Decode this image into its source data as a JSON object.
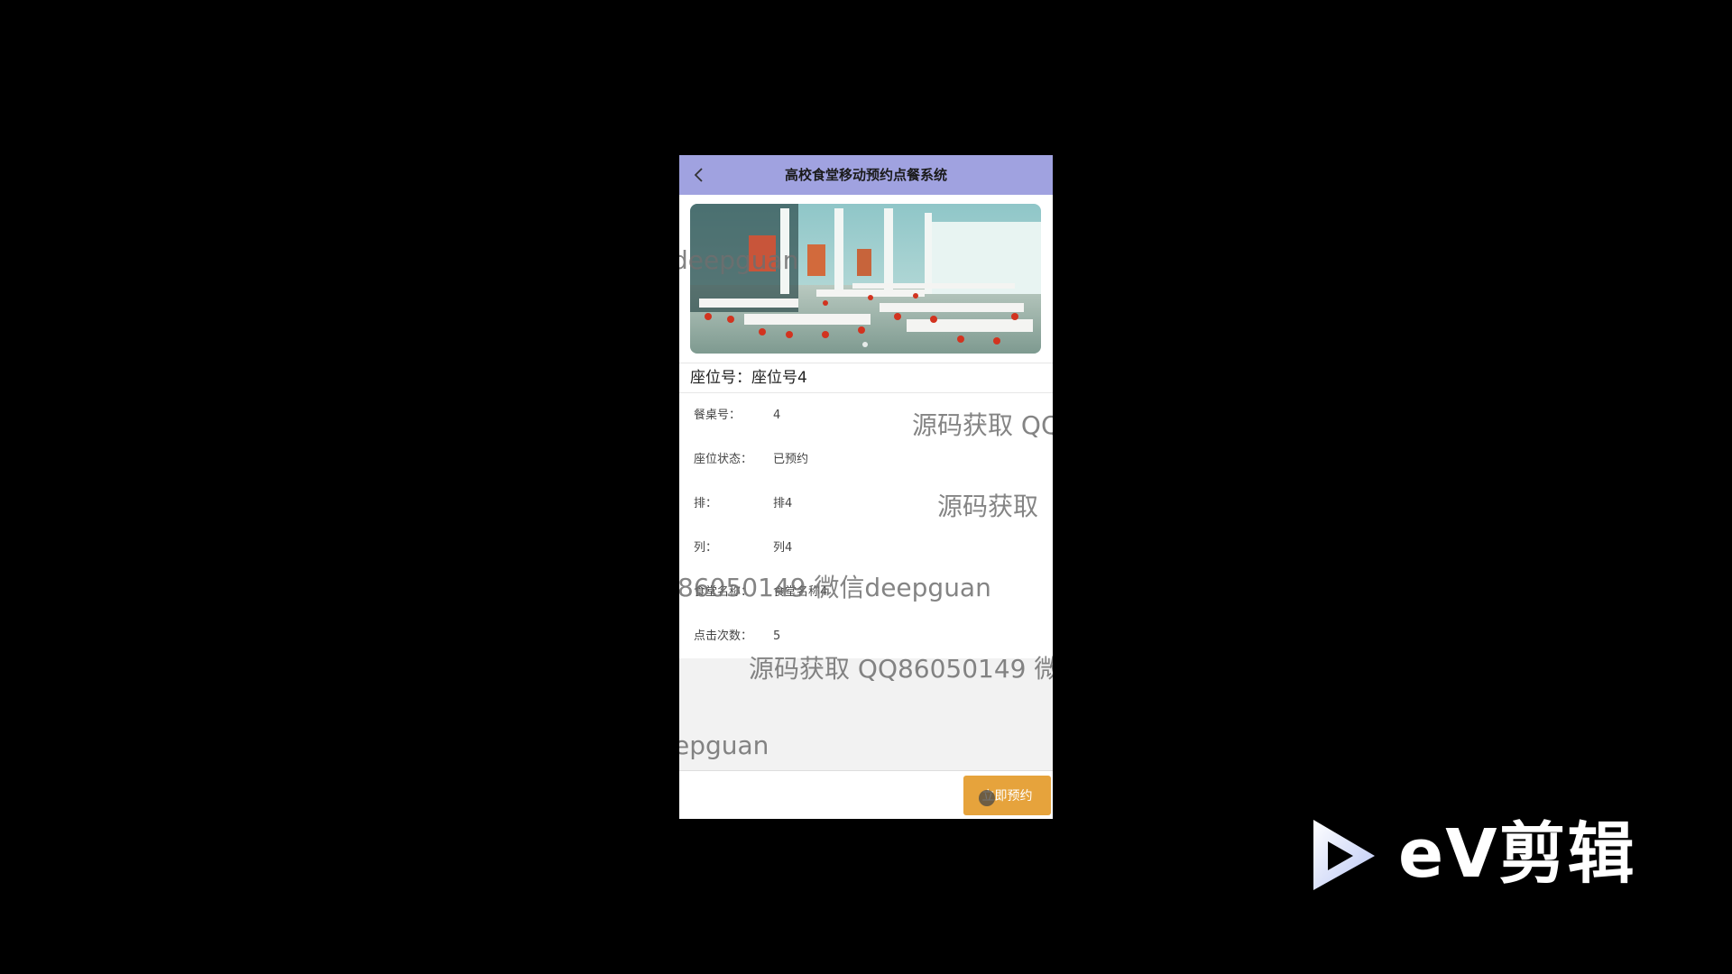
{
  "header": {
    "title": "高校食堂移动预约点餐系统",
    "back_icon": "chevron-left-icon"
  },
  "banner": {
    "alt": "canteen dining hall photo"
  },
  "seat": {
    "title": "座位号：座位号4"
  },
  "details": [
    {
      "label": "餐桌号：",
      "value": "4"
    },
    {
      "label": "座位状态：",
      "value": "已预约"
    },
    {
      "label": "排：",
      "value": "排4"
    },
    {
      "label": "列：",
      "value": "列4"
    },
    {
      "label": "食堂名称：",
      "value": "食堂名称4"
    },
    {
      "label": "点击次数：",
      "value": "5"
    }
  ],
  "actions": {
    "reserve_label": "立即预约"
  },
  "watermarks": {
    "w1": "deepguan",
    "w2": "源码获取 QQ",
    "w3": "源码获取",
    "w4": "86050149 微信deepguan",
    "w5": "源码获取 QQ86050149 微",
    "w6": "epguan"
  },
  "branding": {
    "logo_text": "eV剪辑"
  },
  "colors": {
    "header_bg": "#a0a2e0",
    "button_bg": "#e6a33c",
    "page_bg": "#000000"
  }
}
